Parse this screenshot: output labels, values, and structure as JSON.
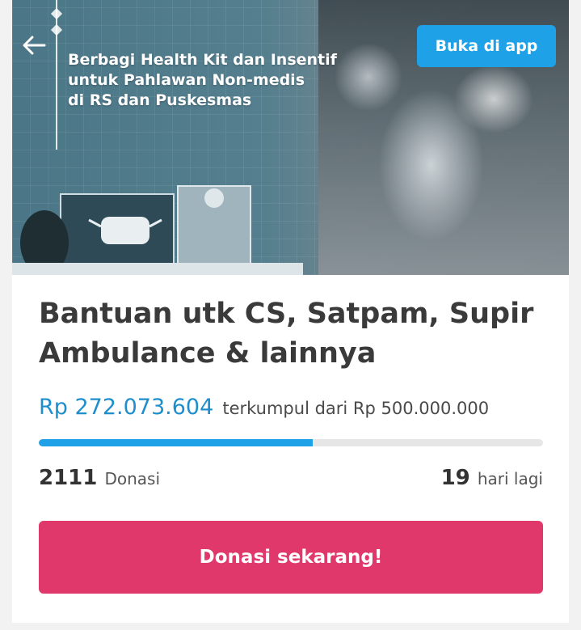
{
  "hero": {
    "headline_lines": [
      "Berbagi Health Kit dan Insentif",
      "untuk Pahlawan Non-medis",
      "di RS dan Puskesmas"
    ],
    "back_icon": "arrow-left-icon",
    "open_app_label": "Buka di app"
  },
  "campaign": {
    "title_lines": [
      "Bantuan utk CS, Satpam, Supir",
      "Ambulance & lainnya"
    ],
    "collected": "Rp 272.073.604",
    "collected_suffix": "terkumpul dari Rp 500.000.000",
    "progress_fraction": 0.544,
    "donations_count": "2111",
    "donations_label": "Donasi",
    "days_left": "19",
    "days_left_label": "hari lagi",
    "donate_label": "Donasi sekarang!"
  },
  "colors": {
    "accent_blue": "#1ea1e6",
    "amount_blue": "#1f8ecd",
    "donate_pink": "#e0386b"
  }
}
